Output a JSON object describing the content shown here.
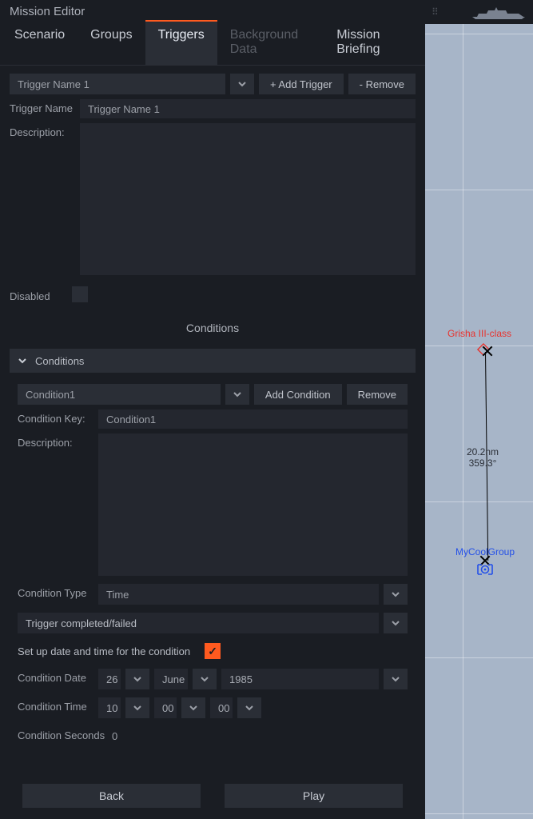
{
  "header": {
    "title": "Mission Editor"
  },
  "tabs": [
    {
      "label": "Scenario",
      "active": false,
      "disabled": false
    },
    {
      "label": "Groups",
      "active": false,
      "disabled": false
    },
    {
      "label": "Triggers",
      "active": true,
      "disabled": false
    },
    {
      "label": "Background Data",
      "active": false,
      "disabled": true
    },
    {
      "label": "Mission Briefing",
      "active": false,
      "disabled": false
    }
  ],
  "trigger": {
    "selected": "Trigger Name 1",
    "add_btn": "+ Add Trigger",
    "remove_btn": "- Remove",
    "name_label": "Trigger Name",
    "name_value": "Trigger Name 1",
    "desc_label": "Description:",
    "desc_value": "",
    "disabled_label": "Disabled",
    "disabled_checked": false
  },
  "sections": {
    "conditions_title": "Conditions",
    "conditions_header": "Conditions"
  },
  "condition": {
    "selected": "Condition1",
    "add_btn": "Add Condition",
    "remove_btn": "Remove",
    "key_label": "Condition Key:",
    "key_value": "Condition1",
    "desc_label": "Description:",
    "desc_value": "",
    "type_label": "Condition Type",
    "type_value": "Time",
    "completed_label": "Trigger completed/failed",
    "completed_value": "",
    "setup_label": "Set up date and time for the condition",
    "setup_checked": true,
    "date_label": "Condition Date",
    "date_day": "26",
    "date_month": "June",
    "date_year": "1985",
    "time_label": "Condition Time",
    "time_h": "10",
    "time_m": "00",
    "time_s": "00",
    "seconds_label": "Condition Seconds",
    "seconds_value": "0"
  },
  "footer": {
    "back": "Back",
    "play": "Play"
  },
  "map": {
    "unit_a_label": "Grisha III-class",
    "unit_b_label": "MyCoolGroup",
    "distance": "20.2nm",
    "bearing": "359.3°"
  }
}
